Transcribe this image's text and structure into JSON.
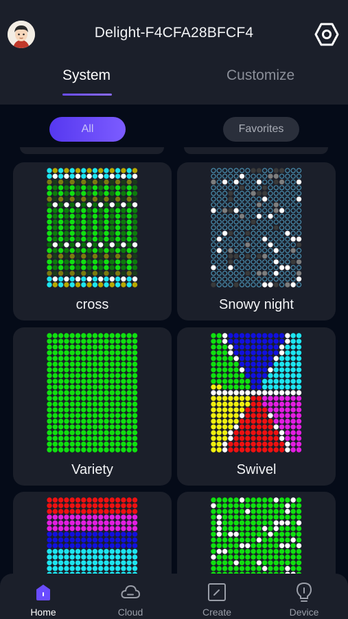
{
  "header": {
    "title": "Delight-F4CFA28BFCF4",
    "tabs": [
      {
        "label": "System",
        "active": true
      },
      {
        "label": "Customize",
        "active": false
      }
    ]
  },
  "filters": [
    {
      "label": "All",
      "active": true
    },
    {
      "label": "Favorites",
      "active": false
    }
  ],
  "cards": [
    {
      "label": "cross",
      "pattern": "cross"
    },
    {
      "label": "Snowy night",
      "pattern": "snowy"
    },
    {
      "label": "Variety",
      "pattern": "variety"
    },
    {
      "label": "Swivel",
      "pattern": "swivel"
    },
    {
      "label": "",
      "pattern": "stripes"
    },
    {
      "label": "",
      "pattern": "sparkle"
    }
  ],
  "bottom_nav": [
    {
      "label": "Home",
      "icon": "home-icon",
      "active": true
    },
    {
      "label": "Cloud",
      "icon": "cloud-icon",
      "active": false
    },
    {
      "label": "Create",
      "icon": "create-icon",
      "active": false
    },
    {
      "label": "Device",
      "icon": "lightbulb-icon",
      "active": false
    }
  ],
  "colors": {
    "accent": "#6a4cff",
    "background": "#050b18",
    "surface": "#1b1f2a",
    "led_green": "#10e010",
    "led_cyan": "#1de5f0",
    "led_red": "#ee1111",
    "led_magenta": "#e21ee0",
    "led_blue": "#1111dd",
    "led_yellow": "#f0f010"
  }
}
